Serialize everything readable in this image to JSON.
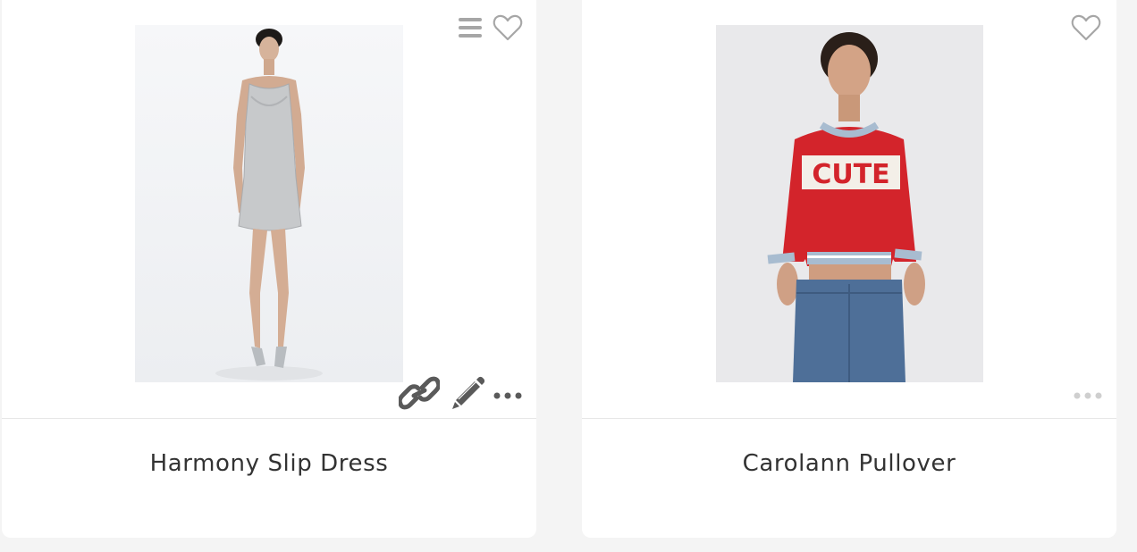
{
  "products": [
    {
      "title": "Harmony Slip Dress",
      "image_alt": "Model wearing silver slip dress",
      "icons": [
        "menu-icon",
        "heart-icon",
        "link-icon",
        "pencil-icon",
        "more-icon"
      ]
    },
    {
      "title": "Carolann Pullover",
      "image_alt": "Model wearing red CUTE cropped sweater and jeans",
      "sweater_text": "CUTE",
      "icons": [
        "heart-icon",
        "more-icon"
      ]
    }
  ],
  "colors": {
    "icon_gray": "#a6a6a6",
    "icon_dark": "#5a5a5a",
    "sweater_red": "#d3242b",
    "denim": "#4e6f98"
  }
}
